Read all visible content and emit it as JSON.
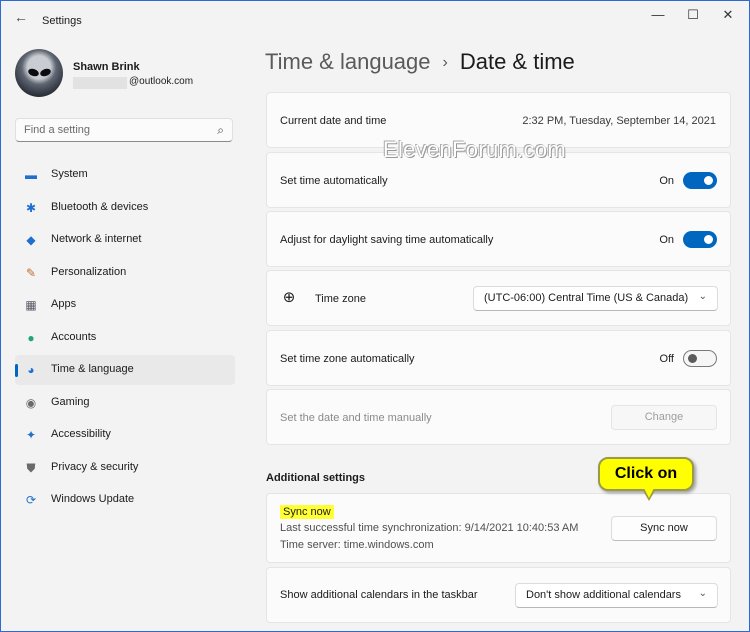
{
  "window": {
    "title": "Settings",
    "back_glyph": "←",
    "minimize_glyph": "—",
    "maximize_glyph": "☐",
    "close_glyph": "✕"
  },
  "profile": {
    "name": "Shawn Brink",
    "email_domain": "@outlook.com"
  },
  "search": {
    "placeholder": "Find a setting",
    "icon": "search-icon",
    "glyph": "⌕"
  },
  "sidebar": {
    "items": [
      {
        "label": "System",
        "icon": "monitor-icon",
        "glyph": "▬",
        "color": "#1f6fd1"
      },
      {
        "label": "Bluetooth & devices",
        "icon": "bluetooth-icon",
        "glyph": "✱",
        "color": "#1f6fd1"
      },
      {
        "label": "Network & internet",
        "icon": "wifi-icon",
        "glyph": "◆",
        "color": "#1f6fd1"
      },
      {
        "label": "Personalization",
        "icon": "brush-icon",
        "glyph": "✎",
        "color": "#c46a2a"
      },
      {
        "label": "Apps",
        "icon": "apps-icon",
        "glyph": "▦",
        "color": "#5a5a6a"
      },
      {
        "label": "Accounts",
        "icon": "person-icon",
        "glyph": "●",
        "color": "#22a37a"
      },
      {
        "label": "Time & language",
        "icon": "globe-clock-icon",
        "glyph": "◕",
        "color": "#1f6fd1"
      },
      {
        "label": "Gaming",
        "icon": "controller-icon",
        "glyph": "◉",
        "color": "#6a6a6a"
      },
      {
        "label": "Accessibility",
        "icon": "accessibility-icon",
        "glyph": "✦",
        "color": "#1f6fd1"
      },
      {
        "label": "Privacy & security",
        "icon": "shield-icon",
        "glyph": "⛊",
        "color": "#6a6a6a"
      },
      {
        "label": "Windows Update",
        "icon": "update-icon",
        "glyph": "⟳",
        "color": "#1f6fd1"
      }
    ],
    "active_index": 6
  },
  "breadcrumb": {
    "parent": "Time & language",
    "separator": "›",
    "current": "Date & time"
  },
  "main": {
    "current_date_label": "Current date and time",
    "current_date_value": "2:32 PM, Tuesday, September 14, 2021",
    "set_time_auto_label": "Set time automatically",
    "set_time_auto_state": "On",
    "dst_auto_label": "Adjust for daylight saving time automatically",
    "dst_auto_state": "On",
    "time_zone_label": "Time zone",
    "time_zone_value": "(UTC-06:00) Central Time (US & Canada)",
    "tz_icon_glyph": "⊕",
    "dropdown_chevron": "⌄",
    "set_tz_auto_label": "Set time zone automatically",
    "set_tz_auto_state": "Off",
    "manual_label": "Set the date and time manually",
    "manual_button": "Change",
    "additional_settings_title": "Additional settings",
    "sync_title": "Sync now",
    "last_sync": "Last successful time synchronization: 9/14/2021 10:40:53 AM",
    "time_server": "Time server: time.windows.com",
    "sync_button": "Sync now",
    "calendars_label": "Show additional calendars in the taskbar",
    "calendars_value": "Don't show additional calendars"
  },
  "overlay": {
    "watermark": "ElevenForum.com",
    "callout": "Click on"
  },
  "colors": {
    "accent": "#0067c0",
    "highlight": "#ffff33",
    "callout": "#ffff00",
    "window_border": "#2d6bd1"
  }
}
